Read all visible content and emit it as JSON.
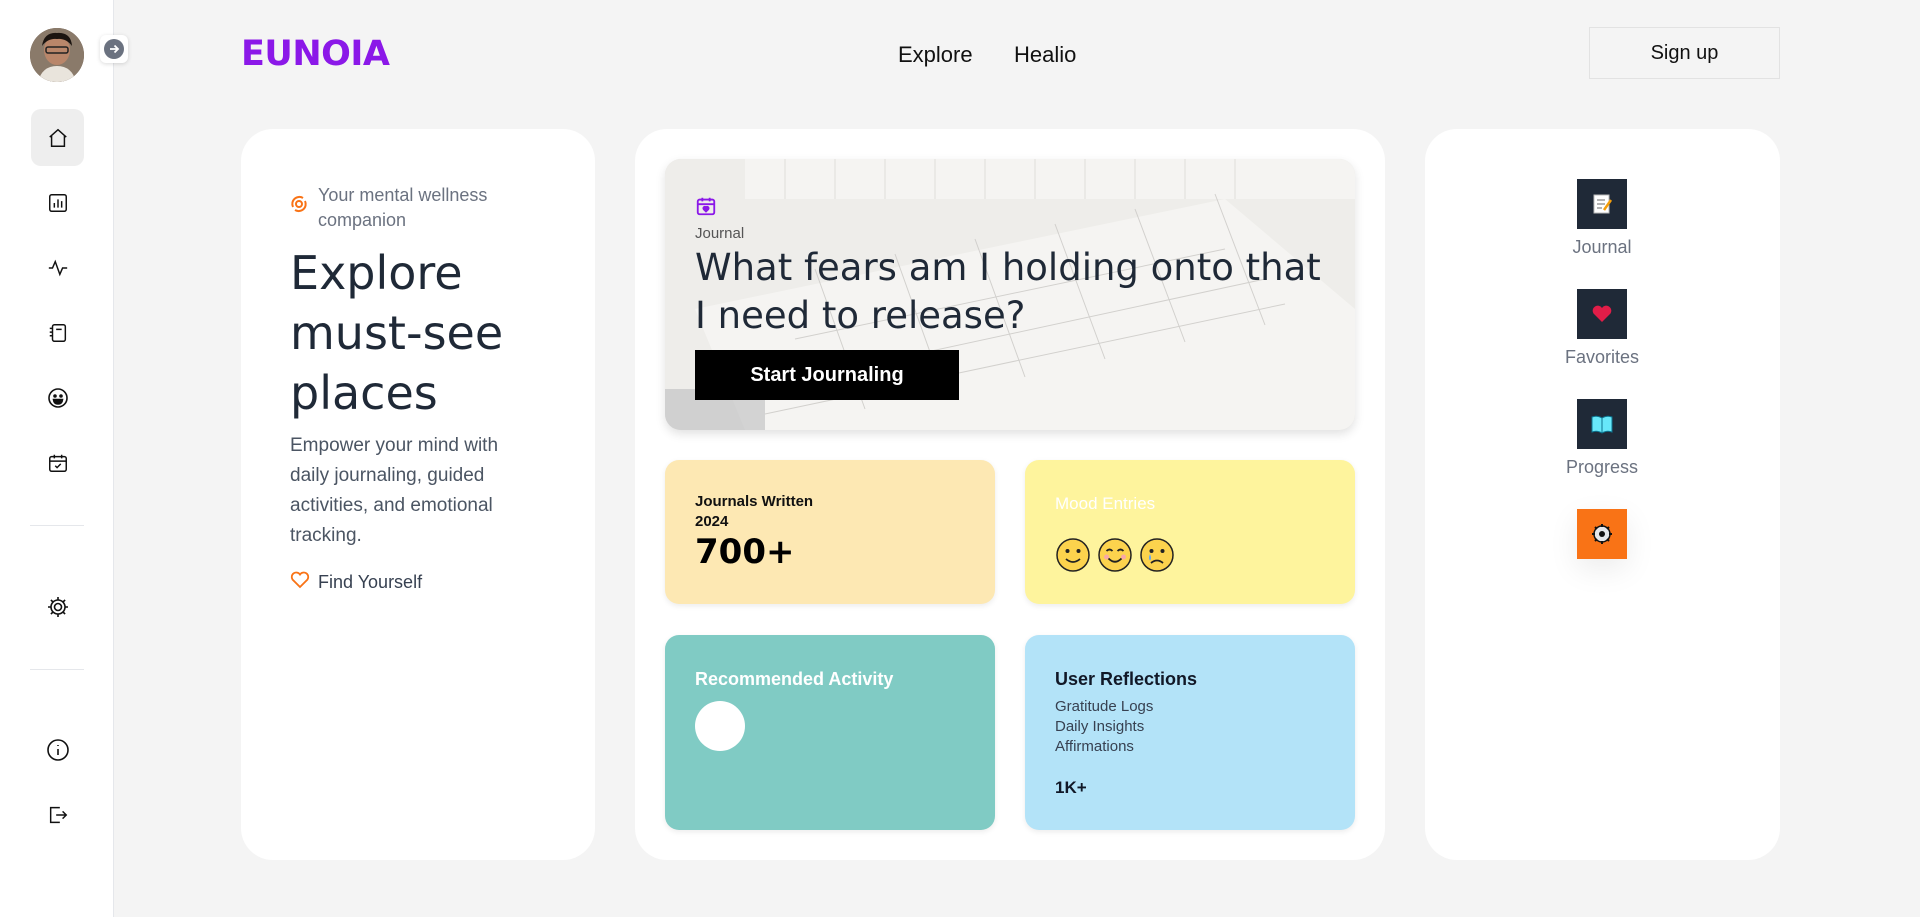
{
  "brand": "EUNOIA",
  "nav": {
    "explore": "Explore",
    "healio": "Healio",
    "signup": "Sign up"
  },
  "sidebar": {
    "items": [
      {
        "name": "home-icon"
      },
      {
        "name": "bar-chart-icon"
      },
      {
        "name": "activity-icon"
      },
      {
        "name": "notebook-icon"
      },
      {
        "name": "smiley-icon"
      },
      {
        "name": "calendar-check-icon"
      },
      {
        "name": "settings-icon"
      },
      {
        "name": "info-icon"
      },
      {
        "name": "logout-icon"
      }
    ]
  },
  "hero": {
    "tagline": "Your mental wellness companion",
    "title": "Explore must-see places",
    "description": "Empower your mind with daily journaling, guided activities, and emotional tracking.",
    "link": "Find Yourself"
  },
  "journal_banner": {
    "label": "Journal",
    "question": "What fears am I holding onto that I need to release?",
    "button": "Start Journaling"
  },
  "tiles": {
    "journals": {
      "label_line1": "Journals Written",
      "label_line2": "2024",
      "value": "700+"
    },
    "mood": {
      "title": "Mood Entries",
      "emojis": [
        "🙂",
        "😊",
        "😢"
      ]
    },
    "activity": {
      "title": "Recommended Activity"
    },
    "reflections": {
      "title": "User Reflections",
      "items": [
        "Gratitude Logs",
        "Daily Insights",
        "Affirmations"
      ],
      "count": "1K+"
    }
  },
  "right_menu": [
    {
      "label": "Journal",
      "icon": "memo-icon"
    },
    {
      "label": "Favorites",
      "icon": "heart-icon"
    },
    {
      "label": "Progress",
      "icon": "open-book-icon"
    },
    {
      "label": "",
      "icon": "gear-icon"
    }
  ],
  "colors": {
    "brand": "#8b18e8",
    "journals_tile": "#fde8b3",
    "mood_tile": "#fef49d",
    "activity_tile": "#80cbc4",
    "reflections_tile": "#b3e3f8",
    "accent_orange": "#f97316"
  }
}
